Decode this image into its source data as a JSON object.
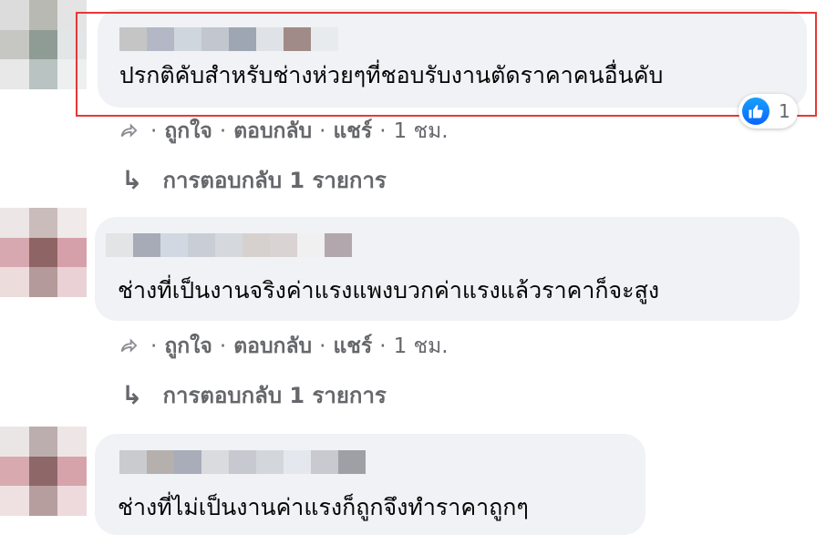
{
  "comments": [
    {
      "text": "ปรกติคับสำหรับช่างห่วยๆที่ชอบรับงานตัดราคาคนอื่นคับ",
      "actions": {
        "like": "ถูกใจ",
        "reply": "ตอบกลับ",
        "share": "แชร์",
        "time": "1 ชม."
      },
      "reaction": {
        "icon": "like-thumb-icon",
        "count": "1"
      },
      "replies_label": "การตอบกลับ 1 รายการ",
      "highlighted": true
    },
    {
      "text": "ช่างที่เป็นงานจริงค่าแรงแพงบวกค่าแรงแล้วราคาก็จะสูง",
      "actions": {
        "like": "ถูกใจ",
        "reply": "ตอบกลับ",
        "share": "แชร์",
        "time": "1 ชม."
      },
      "replies_label": "การตอบกลับ 1 รายการ"
    },
    {
      "text": "ช่างที่ไม่เป็นงานค่าแรงก็ถูกจึงทำราคาถูกๆ"
    }
  ],
  "colors": {
    "bubble": "#f0f2f5",
    "highlight": "#e53935",
    "secondary_text": "#65676b",
    "like_blue": "#0866ff"
  }
}
